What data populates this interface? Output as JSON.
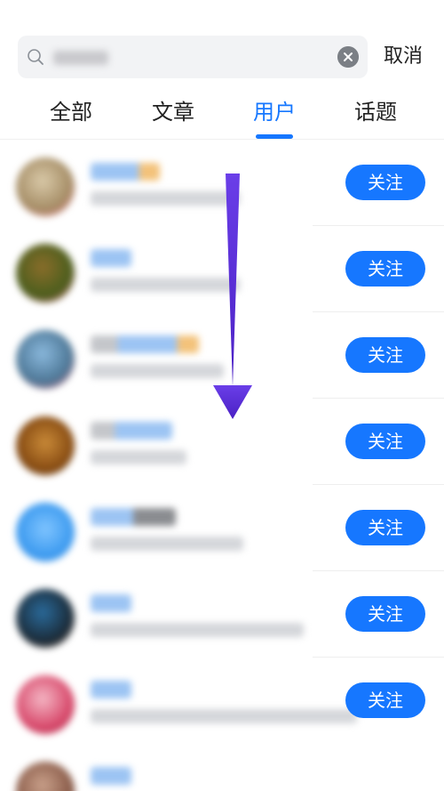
{
  "search": {
    "cancel_label": "取消"
  },
  "tabs": [
    {
      "label": "全部"
    },
    {
      "label": "文章"
    },
    {
      "label": "用户"
    },
    {
      "label": "话题"
    }
  ],
  "active_tab": "用户",
  "follow_label": "关注",
  "colors": {
    "accent": "#1677ff",
    "arrow": "#5b2fd6"
  }
}
